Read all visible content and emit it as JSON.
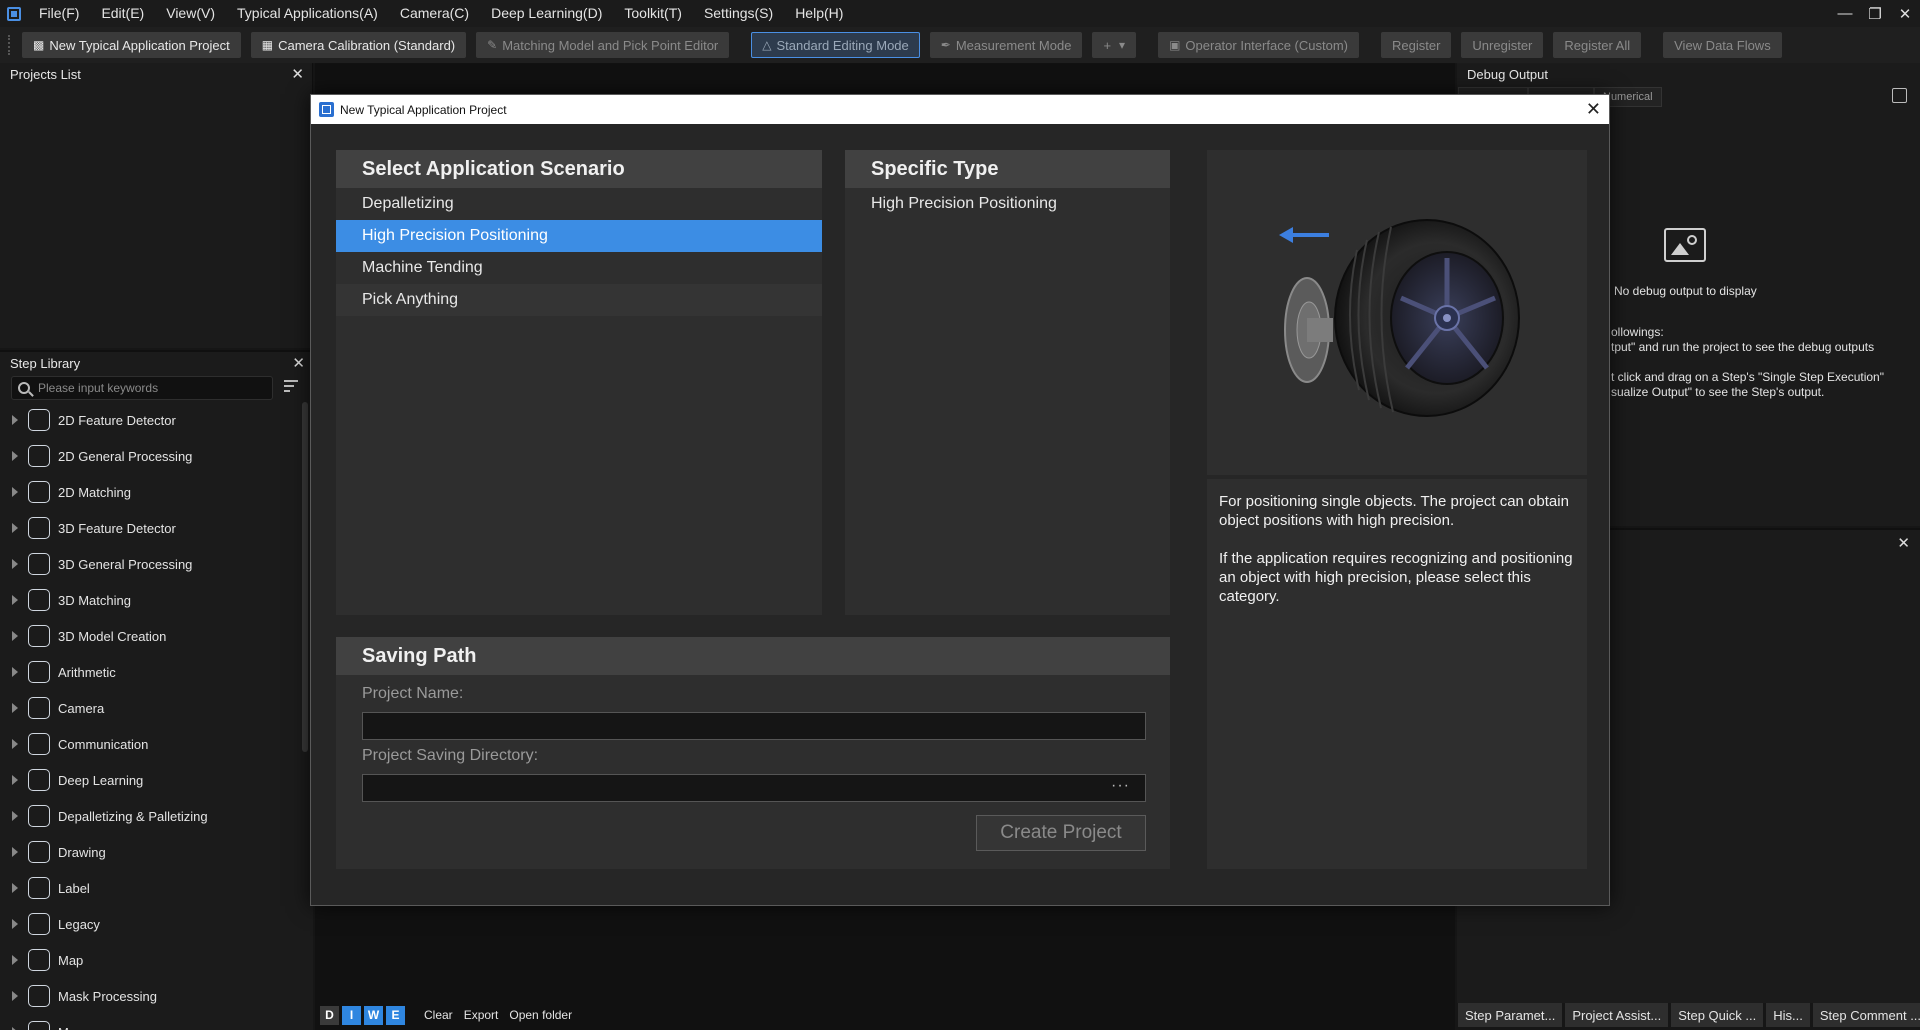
{
  "menubar": {
    "items": [
      "File(F)",
      "Edit(E)",
      "View(V)",
      "Typical Applications(A)",
      "Camera(C)",
      "Deep Learning(D)",
      "Toolkit(T)",
      "Settings(S)",
      "Help(H)"
    ]
  },
  "toolbar": {
    "new_project": "New Typical Application Project",
    "camera_calibration": "Camera Calibration (Standard)",
    "matching_editor": "Matching Model and Pick Point Editor",
    "standard_mode": "Standard Editing Mode",
    "measurement_mode": "Measurement Mode",
    "plus": "+",
    "operator_interface": "Operator Interface (Custom)",
    "register": "Register",
    "unregister": "Unregister",
    "register_all": "Register All",
    "view_data_flows": "View Data Flows"
  },
  "projects_panel": {
    "title": "Projects List"
  },
  "step_library": {
    "title": "Step Library",
    "search_placeholder": "Please input keywords",
    "items": [
      {
        "label": "2D Feature Detector",
        "icon": "2d-feature-detector-icon"
      },
      {
        "label": "2D General Processing",
        "icon": "2d-general-processing-icon"
      },
      {
        "label": "2D Matching",
        "icon": "2d-matching-icon"
      },
      {
        "label": "3D Feature Detector",
        "icon": "3d-feature-detector-icon"
      },
      {
        "label": "3D General Processing",
        "icon": "3d-general-processing-icon"
      },
      {
        "label": "3D Matching",
        "icon": "3d-matching-icon"
      },
      {
        "label": "3D Model Creation",
        "icon": "3d-model-creation-icon"
      },
      {
        "label": "Arithmetic",
        "icon": "arithmetic-icon"
      },
      {
        "label": "Camera",
        "icon": "camera-icon"
      },
      {
        "label": "Communication",
        "icon": "communication-icon"
      },
      {
        "label": "Deep Learning",
        "icon": "deep-learning-icon"
      },
      {
        "label": "Depalletizing & Palletizing",
        "icon": "depalletizing-icon"
      },
      {
        "label": "Drawing",
        "icon": "drawing-icon"
      },
      {
        "label": "Label",
        "icon": "label-icon"
      },
      {
        "label": "Legacy",
        "icon": "legacy-icon"
      },
      {
        "label": "Map",
        "icon": "map-icon"
      },
      {
        "label": "Mask Processing",
        "icon": "mask-processing-icon"
      },
      {
        "label": "M...",
        "icon": "misc-icon"
      }
    ]
  },
  "log_bar": {
    "levels": [
      "D",
      "I",
      "W",
      "E"
    ],
    "clear": "Clear",
    "export": "Export",
    "open_folder": "Open folder"
  },
  "debug_output": {
    "title": "Debug Output",
    "tabs": [
      "",
      "",
      "Numerical"
    ],
    "empty_text": "No debug output to display",
    "line1": "ollowings:",
    "line2": "tput\" and run the project to see the debug outputs",
    "line3": "t click and drag on a Step's \"Single Step Execution\"",
    "line4": "sualize Output\" to see the Step's output."
  },
  "bottom_tabs": [
    "Step Paramet...",
    "Project Assist...",
    "Step Quick ...",
    "His...",
    "Step Comment ..."
  ],
  "dialog": {
    "title": "New Typical Application Project",
    "scenario": {
      "heading": "Select Application Scenario",
      "items": [
        "Depalletizing",
        "High Precision Positioning",
        "Machine Tending",
        "Pick Anything"
      ],
      "selected_index": 1
    },
    "type": {
      "heading": "Specific Type",
      "items": [
        "High Precision Positioning"
      ]
    },
    "description": {
      "p1": "For positioning single objects. The project can obtain object positions with high precision.",
      "p2": "If the application requires recognizing and positioning an object with high precision, please select this category."
    },
    "saving": {
      "heading": "Saving Path",
      "name_label": "Project Name:",
      "name_value": "",
      "dir_label": "Project Saving Directory:",
      "dir_value": "",
      "dir_button": "···",
      "create_button": "Create Project"
    }
  },
  "colors": {
    "accent": "#3c8de4",
    "window_bg": "#161616",
    "dialog_bg": "#262626",
    "panel_bg": "#2e2e2e"
  }
}
